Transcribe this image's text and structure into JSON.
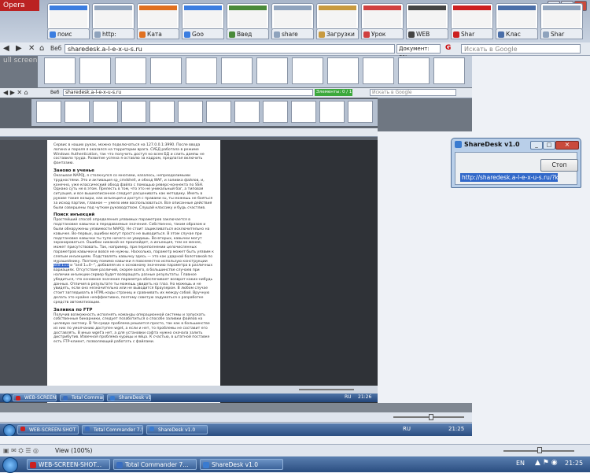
{
  "browser": {
    "opera_label": "Opera",
    "tabs": [
      {
        "label": "поис",
        "icon": "google-icon",
        "color": "#3b7de0"
      },
      {
        "label": "http:",
        "icon": "page-icon",
        "color": "#8fa3bd"
      },
      {
        "label": "Ката",
        "icon": "catalog-icon",
        "color": "#e07020"
      },
      {
        "label": "Goo",
        "icon": "google-icon",
        "color": "#3b7de0"
      },
      {
        "label": "Введ",
        "icon": "page-icon",
        "color": "#4a8a3a"
      },
      {
        "label": "share",
        "icon": "page-icon",
        "color": "#8fa3bd"
      },
      {
        "label": "Загрузки",
        "icon": "downloads-icon",
        "color": "#c89a40"
      },
      {
        "label": "Урок",
        "icon": "page-icon",
        "color": "#d04040"
      },
      {
        "label": "WEB",
        "icon": "camera-icon",
        "color": "#444"
      },
      {
        "label": "Shar",
        "icon": "youtube-icon",
        "color": "#cc2020"
      },
      {
        "label": "Клас",
        "icon": "page-icon",
        "color": "#4a6ea8"
      },
      {
        "label": "Shar",
        "icon": "page-icon",
        "color": "#8fa3bd"
      }
    ],
    "nav_web": "Веб",
    "url": "sharedesk.a-l-e-x-u-s.ru",
    "document_progress": "Документ:   0%",
    "search_placeholder": "Искать в Google",
    "fullscreen_label": "ull screen"
  },
  "nested": {
    "nav_web": "Веб",
    "url": "sharedesk.a-l-e-x-u-s.ru",
    "elements_progress": "Элементы:   0 / 1",
    "search_placeholder": "Искать в Google"
  },
  "article": {
    "intro": "Сервис в наших руках, можно подключаться на 127.0.0.1:3990. После ввода логина и пароля я оказался на территории врага. СУБД работала в режиме Windows Authentication, так что получить доступ ко всем БД и слить дампы не составило труда. Развитие успеха я оставлю за кадром, предлагая включить фантазию.",
    "s1_title": "Заново в ученье",
    "s1_text": "Оказывая NAPOJ, я столкнулся со многими, казалось, непреодолимыми трудностями. Это и активация sp_cmdshell, и обход WAF, и заливка файлов, и, конечно, уже классический обход файла с помощью реверс-коннекта по SSH. Однако суть не в этом. Прелесть в том, что это не уникальный баг, а типовая ситуация, и все вышеописанное следует расценивать как методику. Иметь в рукаве такие козыри, как инъекция и доступ с правами su, ты можешь не бояться за исход партии, главное — умело ими воспользоваться. Все описанные действия были совершены под чутким руководством. Слушай классику и будь счастлив.",
    "s2_title": "Поиск инъекций",
    "s2_text_a": "Простейший способ определения уязвимых параметров заключается в подстановке кавычки в передаваемые значения. Собственно, таким образом и были обнаружены уязвимости NAPOJ. Не стоит зацикливаться исключительно на кавычке. Во-первых, ошибки могут просто не выводиться. В этом случае при подстановке кавычки ты тупо ничего не увидишь. Во-вторых, кавычки могут экранироваться. Ошибки никакой не произойдет, а инъекция, тем не менее, может присутствовать. Так, например, при переполнении целочисленных параметров кавычки и вовсе не нужны. Насколько, параметр может быть уязвим к слепым инъекциям. Подставлять кавычку здесь — это как ударной болотовкой по мурашейнику. Поэтому помимо кавычки я повсеместно использую конструкции",
    "s2_highlight": "and 1=1",
    "s2_text_b": "и \"and 1=0--\", добавляя их к основному значению параметра в различных вариациях. Отсутствие различий, скорее всего, в большинстве случаев при наличии инъекции сервер будет возвращать разные результаты. Главное убедиться, что основное значение параметра обеспечивает возврат каких-нибудь данных. Отличия в результате ты можешь увидеть на глаз. Но можешь и не увидеть, если оно незначительно или не выводится браузером. В любом случае стоит заглядывать в HTML-коды страниц и сравнивать их между собой. Вручную делать это крайне неэффективно, поэтому советую задуматься о разработке средств автоматизации.",
    "s3_title": "Заливка по FTP",
    "s3_text": "Получив возможность исполнять команды операционной системы и запускать собственные бинарники, следует позаботиться о способе заливки файлов на целевую систему. В Чя-среде проблема решается просто, так как в большинстве из них по умолчанию доступен wget, а если и нет, то проблемы не составит его доставлять. В иных wget'а нет, а для установки софта нужно сначала залить дистрибутив. Извечная проблема курицы и яйца. К счастью, в штатной поставке есть FTP-клиент, позволяющий работать с файлами."
  },
  "sharedesk": {
    "title": "ShareDesk v1.0",
    "stop_label": "Стоп",
    "url": "http://sharedesk.a-l-e-x-u-s.ru/?key=114"
  },
  "status_bar": {
    "view_label": "View (100%)"
  },
  "taskbar": {
    "items": [
      {
        "label": "WEB-SCREEN-SHOT...",
        "color": "#cc2020"
      },
      {
        "label": "Total Commander 7...",
        "color": "#3a6ec0"
      },
      {
        "label": "ShareDesk v1.0",
        "color": "#3a7bd0"
      }
    ],
    "language": "EN",
    "time": "21:25"
  },
  "inner_taskbar": {
    "items": [
      {
        "label": "WEB-SCREEN-SHOT",
        "color": "#cc2020"
      },
      {
        "label": "Total Commander 7.5",
        "color": "#3a6ec0"
      },
      {
        "label": "ShareDesk v1.0",
        "color": "#3a7bd0"
      }
    ],
    "language": "RU",
    "time": "21:25"
  },
  "inner_taskbar2": {
    "items": [
      {
        "label": "WEB-SCREEN-SHOT",
        "color": "#cc2020"
      },
      {
        "label": "Total Commander 7",
        "color": "#3a6ec0"
      },
      {
        "label": "ShareDesk v1.0",
        "color": "#3a7bd0"
      }
    ],
    "language": "RU",
    "time": "21:26"
  }
}
